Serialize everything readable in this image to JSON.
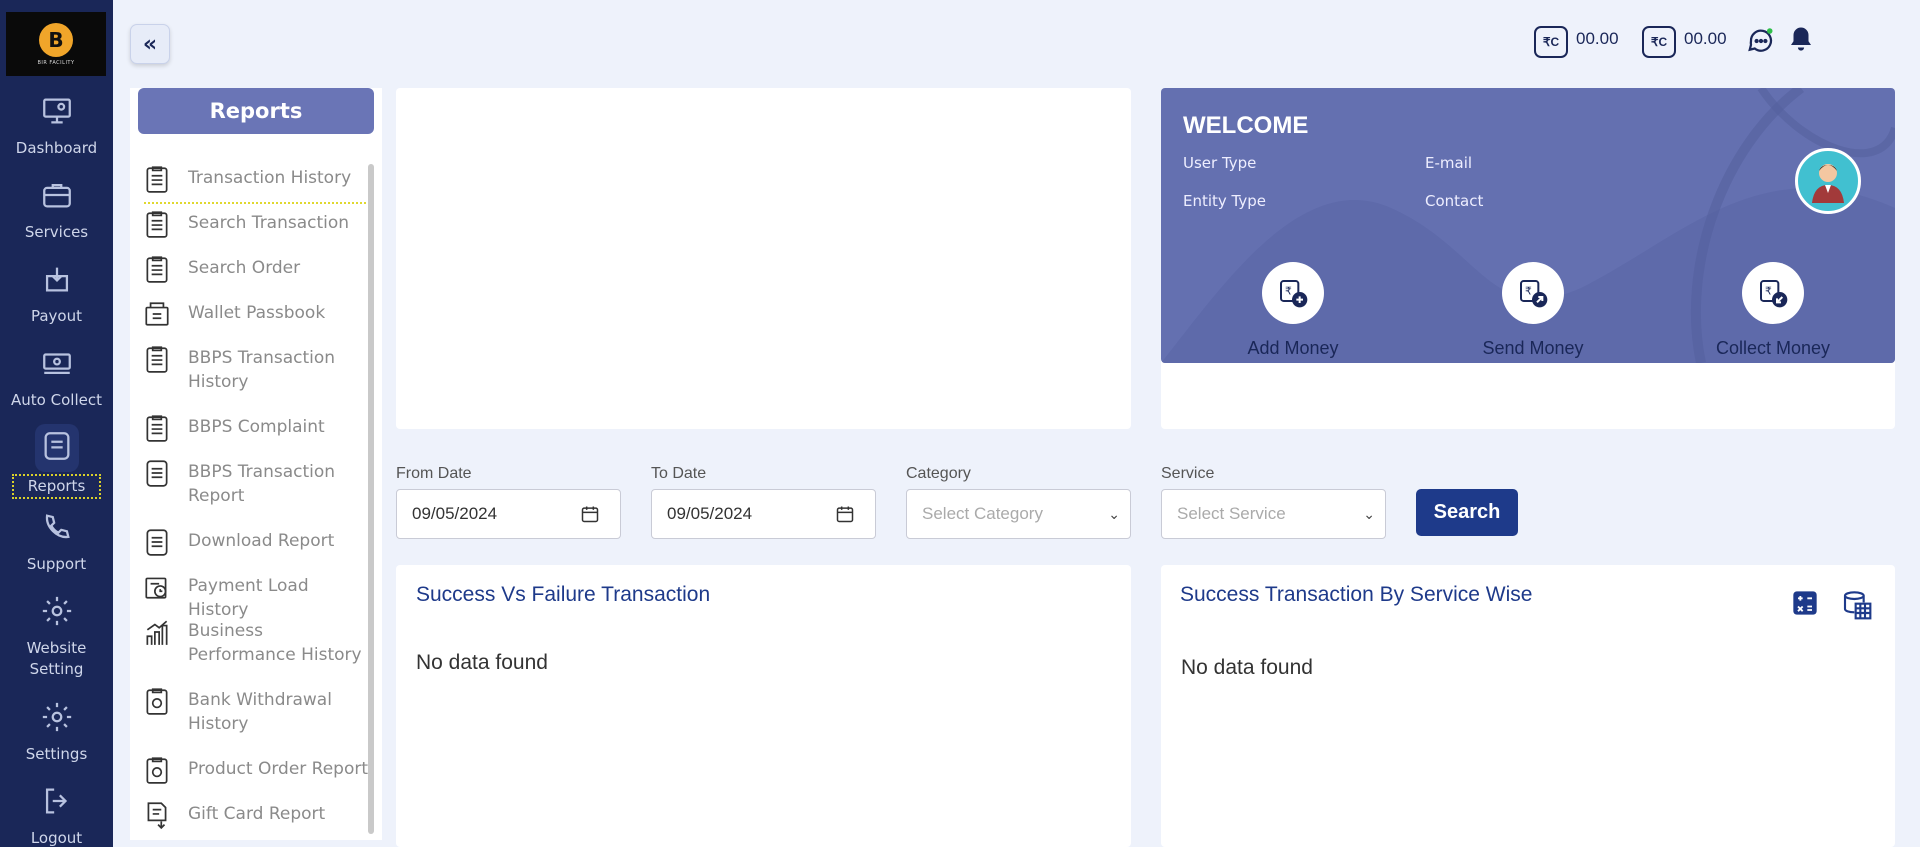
{
  "app": {
    "logo_text": "B",
    "logo_subtext": "BIR FACILITY"
  },
  "nav": {
    "items": [
      {
        "label": "Dashboard"
      },
      {
        "label": "Services"
      },
      {
        "label": "Payout"
      },
      {
        "label": "Auto Collect"
      },
      {
        "label": "Reports"
      },
      {
        "label": "Support"
      },
      {
        "label": "Website Setting"
      },
      {
        "label": "Settings"
      },
      {
        "label": "Logout"
      }
    ]
  },
  "topbar": {
    "wallets": [
      {
        "value": "00.00"
      },
      {
        "value": "00.00"
      }
    ]
  },
  "reports": {
    "title": "Reports",
    "items": [
      {
        "label": "Transaction History"
      },
      {
        "label": "Search Transaction"
      },
      {
        "label": "Search Order"
      },
      {
        "label": "Wallet Passbook"
      },
      {
        "label": "BBPS Transaction History"
      },
      {
        "label": "BBPS Complaint"
      },
      {
        "label": "BBPS Transaction Report"
      },
      {
        "label": "Download Report"
      },
      {
        "label": "Payment Load History"
      },
      {
        "label": "Business Performance History"
      },
      {
        "label": "Bank Withdrawal History"
      },
      {
        "label": "Product Order Report"
      },
      {
        "label": "Gift Card Report"
      }
    ]
  },
  "welcome": {
    "title": "WELCOME",
    "user_type": "User Type",
    "email": "E-mail",
    "entity_type": "Entity Type",
    "contact": "Contact",
    "actions": [
      {
        "label": "Add Money"
      },
      {
        "label": "Send Money"
      },
      {
        "label": "Collect Money"
      }
    ]
  },
  "filters": {
    "from_label": "From Date",
    "from_value": "09/05/2024",
    "to_label": "To Date",
    "to_value": "09/05/2024",
    "category_label": "Category",
    "category_placeholder": "Select Category",
    "service_label": "Service",
    "service_placeholder": "Select Service",
    "search_label": "Search"
  },
  "panels": {
    "left_title": "Success Vs Failure Transaction",
    "left_empty": "No data found",
    "right_title": "Success Transaction By Service Wise",
    "right_empty": "No data found"
  },
  "colors": {
    "nav_bg": "#1a2758",
    "accent": "#1e3a8a",
    "welcome_bg": "#6470b0",
    "reports_header": "#6a75b6"
  }
}
